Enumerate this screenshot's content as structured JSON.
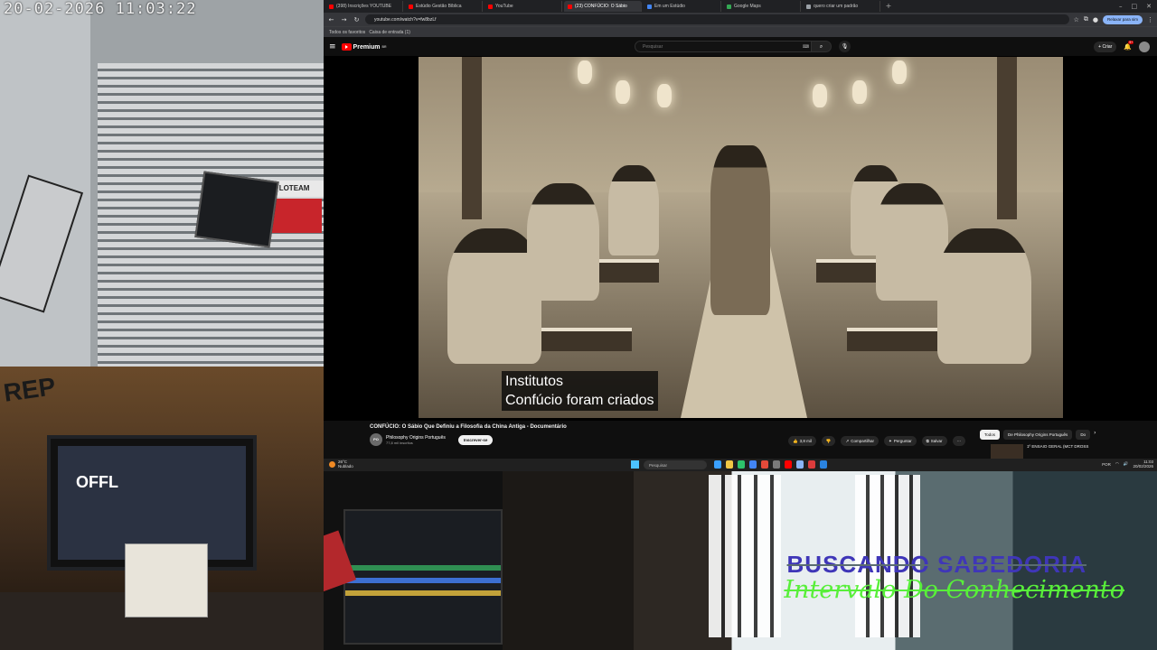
{
  "camera": {
    "timestamp": "20-02-2026 11:03:22",
    "shutter_sign": "MPRA · VENDA · LOTEAM"
  },
  "desk_cam": {
    "wall_text": "REP",
    "monitor_text": "OFFL"
  },
  "overlay": {
    "line1": "BUSCANDO SABEDORIA",
    "line2": "Intervalo Do Conhecimento"
  },
  "browser": {
    "tabs": [
      {
        "label": "(398) Inscrições YOUTUBE",
        "color": "#ff0000"
      },
      {
        "label": "Estúdio Gestão Bíblica",
        "color": "#ff0000"
      },
      {
        "label": "YouTube",
        "color": "#ff0000"
      },
      {
        "label": "(23) CONFÚCIO: O Sábio",
        "color": "#ff0000",
        "active": true
      },
      {
        "label": "Em um Estúdio",
        "color": "#4285f4"
      },
      {
        "label": "Google Maps",
        "color": "#34a853"
      },
      {
        "label": "quero criar um padrão",
        "color": "#9aa0a6"
      }
    ],
    "url": "youtube.com/watch?v=fw8bzLf",
    "bookmarks": [
      "Todos os favoritos",
      "Caixa de entrada (1)"
    ],
    "toolbar_button": "Relaxar para sim"
  },
  "youtube": {
    "logo": "Premium",
    "logo_sup": "BR",
    "search_placeholder": "Pesquisar",
    "create_label": "Criar",
    "notif_count": "9+",
    "caption_line1": "Institutos",
    "caption_line2": "Confúcio foram criados",
    "video_title": "CONFÚCIO: O Sábio Que Definiu a Filosofia da China Antiga - Documentário",
    "channel_name": "Philosophy Origins Português",
    "channel_initials": "PO",
    "channel_subs": "77,8 mil inscritos",
    "subscribe": "Inscrever-se",
    "actions": [
      {
        "icon": "👍",
        "label": "3,8 mil",
        "name": "like-button"
      },
      {
        "icon": "👎",
        "label": "",
        "name": "dislike-button"
      },
      {
        "icon": "↗",
        "label": "Compartilhar",
        "name": "share-button"
      },
      {
        "icon": "✦",
        "label": "Perguntar",
        "name": "ask-button"
      },
      {
        "icon": "⧉",
        "label": "Salvar",
        "name": "save-button"
      },
      {
        "icon": "⋯",
        "label": "",
        "name": "more-button"
      }
    ],
    "chips": [
      "Todos",
      "De Philosophy Origins Português",
      "Do"
    ],
    "side_title": "1º ENSAIO GERAL (MCT DROSS"
  },
  "taskbar": {
    "weather_temp": "26°C",
    "weather_desc": "Nublado",
    "search": "Pesquisar",
    "tray_lang": "POR",
    "time": "11:03",
    "date": "20/02/2026",
    "apps": [
      "#3aa0ff",
      "#f2c744",
      "#2dc26b",
      "#4285f4",
      "#e34a3a",
      "#7a7a7a",
      "#ff0000",
      "#8ab4f8",
      "#db3c3c",
      "#2a83e0"
    ]
  }
}
